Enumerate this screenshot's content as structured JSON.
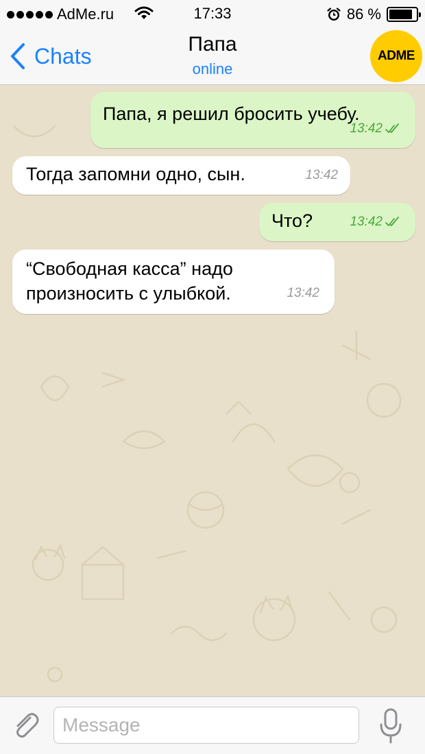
{
  "status_bar": {
    "carrier": "AdMe.ru",
    "time": "17:33",
    "battery_text": "86 %",
    "battery_level": 0.86
  },
  "nav": {
    "back_label": "Chats",
    "title": "Папа",
    "subtitle": "online",
    "avatar_text": "ADME"
  },
  "messages": [
    {
      "direction": "outgoing",
      "text": "Папа, я решил бросить учебу.",
      "time": "13:42",
      "read": true
    },
    {
      "direction": "incoming",
      "text": "Тогда запомни одно, сын.",
      "time": "13:42"
    },
    {
      "direction": "outgoing",
      "text": "Что?",
      "time": "13:42",
      "read": true
    },
    {
      "direction": "incoming",
      "text_lines": [
        "“Свободная касса” надо",
        "произносить с улыбкой."
      ],
      "time": "13:42"
    }
  ],
  "input": {
    "placeholder": "Message"
  },
  "colors": {
    "accent": "#1a82fb",
    "outgoing_bubble": "#dbf5c6",
    "incoming_bubble": "#ffffff",
    "read_ticks": "#4aa83c",
    "wallpaper": "#e9e0cb",
    "avatar": "#ffcc00"
  },
  "icons": [
    "signal-dots-icon",
    "wifi-icon",
    "alarm-icon",
    "battery-icon",
    "chevron-left-icon",
    "double-check-icon",
    "paperclip-icon",
    "microphone-icon"
  ]
}
